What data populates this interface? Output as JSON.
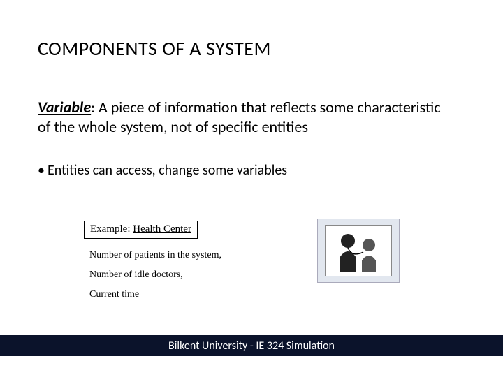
{
  "title": "COMPONENTS OF A SYSTEM",
  "definition": {
    "term": "Variable",
    "text": ": A piece of information that reflects some characteristic of the whole system, not of specific entities"
  },
  "bullet": "Entities can access, change some variables",
  "example_label_prefix": "Example: ",
  "example_label_underlined": "Health Center",
  "example_lines": [
    "Number of patients in the system,",
    "Number of idle doctors,",
    "Current time"
  ],
  "illustration_name": "doctor-patient-illustration",
  "footer": "Bilkent University - IE 324 Simulation"
}
